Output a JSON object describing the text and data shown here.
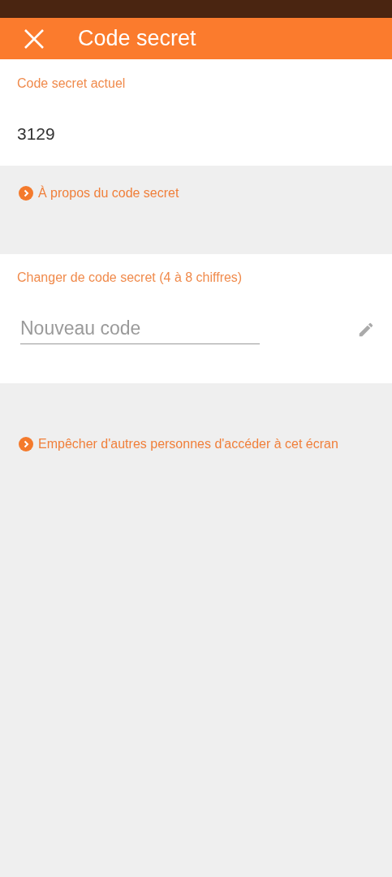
{
  "app_bar": {
    "title": "Code secret"
  },
  "current_code": {
    "label": "Code secret actuel",
    "value": "3129"
  },
  "about_link": {
    "label": "À propos du code secret"
  },
  "change_code": {
    "label": "Changer de code secret (4 à 8 chiffres)",
    "field": {
      "placeholder": "Nouveau code"
    }
  },
  "protect_link": {
    "label": "Empêcher d'autres personnes d'accéder à cet écran"
  }
}
